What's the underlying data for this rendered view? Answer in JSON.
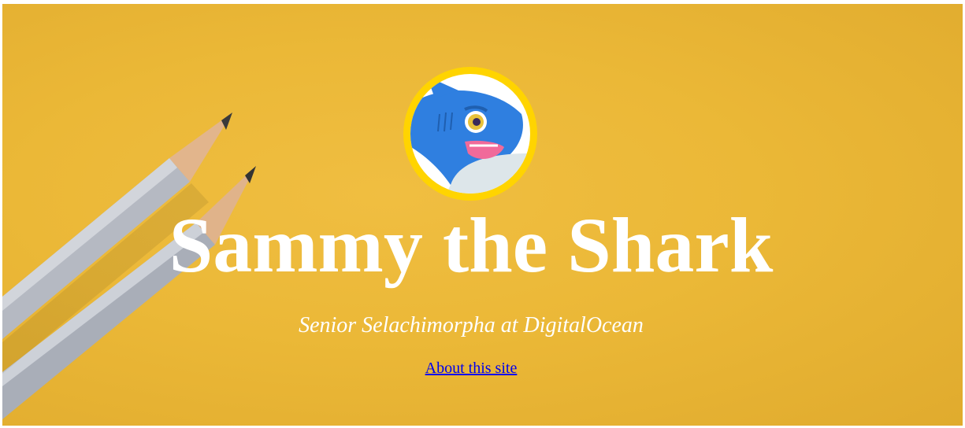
{
  "profile": {
    "name": "Sammy the Shark",
    "tagline": "Senior Selachimorpha at DigitalOcean",
    "about_link": "About this site",
    "avatar_icon": "shark-avatar-icon"
  },
  "background": {
    "image": "yellow-paper-with-pencils",
    "color": "#ebb837"
  },
  "colors": {
    "title": "#ffffff",
    "link": "#0000ee",
    "avatar_ring": "#ffd400",
    "shark_blue": "#2f7fe0"
  }
}
